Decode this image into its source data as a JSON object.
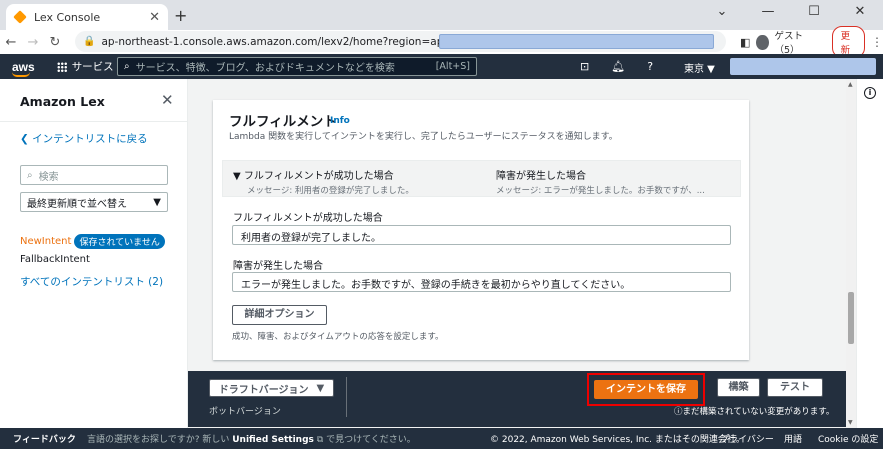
{
  "browser": {
    "tab_title": "Lex Console",
    "tab_close": "✕",
    "new_tab": "+",
    "url": "ap-northeast-1.console.aws.amazon.com/lexv2/home?region=ap-northeast-1#bot/",
    "guest_label": "ゲスト（5）",
    "update_label": "更新",
    "win_min": "⌄",
    "win_minimize": "—",
    "win_max": "☐",
    "win_close": "✕"
  },
  "aws_nav": {
    "logo": "aws",
    "services_label": "サービス",
    "search_placeholder": "サービス、特徴、ブログ、およびドキュメントなどを検索",
    "search_shortcut": "[Alt+S]",
    "region": "東京 ▼"
  },
  "sidebar": {
    "title": "Amazon Lex",
    "back_link": "インテントリストに戻る",
    "search_placeholder": "検索",
    "sort_value": "最終更新順で並べ替え",
    "intents": [
      {
        "name": "NewIntent",
        "badge": "保存されていません"
      },
      {
        "name": "FallbackIntent"
      }
    ],
    "all_intents_link": "すべてのインテントリスト (2)"
  },
  "fulfillment": {
    "title": "フルフィルメント",
    "info_link": "Info",
    "description": "Lambda 関数を実行してインテントを実行し、完了したらユーザーにステータスを通知します。",
    "success_header": "フルフィルメントが成功した場合",
    "success_summary": "メッセージ: 利用者の登録が完了しました。",
    "failure_header": "障害が発生した場合",
    "failure_summary": "メッセージ: エラーが発生しました。お手数ですが、...",
    "success_field_label": "フルフィルメントが成功した場合",
    "success_field_value": "利用者の登録が完了しました。",
    "failure_field_label": "障害が発生した場合",
    "failure_field_value": "エラーが発生しました。お手数ですが、登録の手続きを最初からやり直してください。",
    "advanced_button": "詳細オプション",
    "advanced_desc": "成功、障害、およびタイムアウトの応答を設定します。"
  },
  "action_bar": {
    "version_button": "ドラフトバージョン",
    "version_sub": "ボットバージョン",
    "save_button": "インテントを保存",
    "build_button": "構築",
    "test_button": "テスト",
    "unbuilt_notice": "まだ構築されていない変更があります。"
  },
  "footer": {
    "feedback": "フィードバック",
    "lang_prefix": "言語の選択をお探しですか? 新しい",
    "lang_link": "Unified Settings",
    "lang_suffix": "で見つけてください。",
    "copyright": "© 2022, Amazon Web Services, Inc. またはその関連会社。",
    "privacy": "プライバシー",
    "terms": "用語",
    "cookie": "Cookie の設定"
  },
  "colors": {
    "aws_nav_bg": "#232f3e",
    "primary_button": "#ec7211",
    "link": "#0073bb",
    "highlight_box": "#ee0000"
  }
}
